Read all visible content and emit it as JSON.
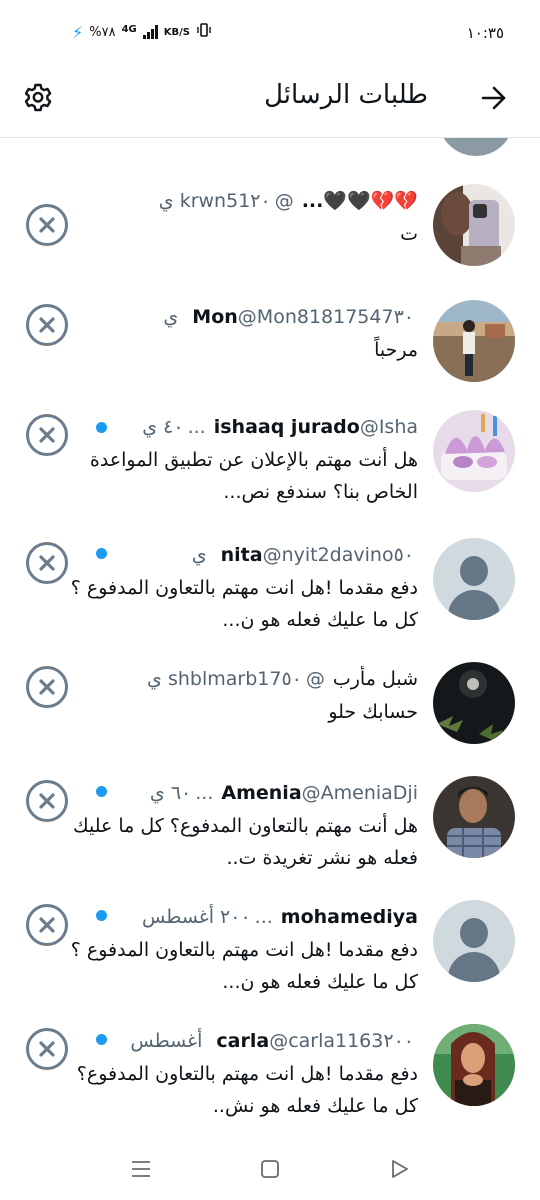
{
  "status_bar": {
    "time": "١٠:٣٥",
    "battery": "%٧٨",
    "network": "4G",
    "speed_unit": "KB/S"
  },
  "header": {
    "title": "طلبات الرسائل"
  },
  "requests": [
    {
      "name": "💔💔🖤🖤...",
      "handle": "@krwn51",
      "time": "٢٠ ي",
      "preview": "ت",
      "unread": false,
      "avatar": "photo-mirror-selfie"
    },
    {
      "name": "Mon",
      "handle": "@Mon81817547",
      "time": "٣٠ ي",
      "preview": "مرحباً",
      "unread": false,
      "avatar": "photo-man-outdoors"
    },
    {
      "name": "ishaaq jurado",
      "handle": "@Isha...",
      "time": "٤٠ ي",
      "preview": "هل أنت مهتم بالإعلان عن تطبيق المواعدة الخاص بنا؟ سندفع نص...",
      "unread": true,
      "avatar": "photo-flowers"
    },
    {
      "name": "nita",
      "handle": "@nyit2davino",
      "time": "٥٠ ي",
      "preview": "دفع مقدما !هل انت مهتم بالتعاون المدفوع ؟ كل ما عليك فعله هو ن...",
      "unread": true,
      "avatar": "default-person"
    },
    {
      "name": "شبل مأرب",
      "handle": "@shblmarb17",
      "time": "٥٠ ي",
      "preview": "حسابك حلو",
      "unread": false,
      "avatar": "photo-night-sky"
    },
    {
      "name": "Amenia",
      "handle": "@AmeniaDji...",
      "time": "٦٠ ي",
      "preview": "هل أنت مهتم بالتعاون المدفوع؟ كل ما عليك فعله هو نشر تغريدة ت..",
      "unread": true,
      "avatar": "photo-young-man"
    },
    {
      "name": "mohamediya",
      "handle": "...",
      "time": "٢٠٠ أغسطس",
      "preview": "دفع مقدما !هل انت مهتم بالتعاون المدفوع ؟ كل ما عليك فعله هو ن...",
      "unread": true,
      "avatar": "default-person"
    },
    {
      "name": "carla",
      "handle": "@carla1163",
      "time": "٢٠٠ أغسطس",
      "preview": "دفع مقدما !هل انت مهتم بالتعاون المدفوع؟ كل ما عليك فعله هو نش..",
      "unread": true,
      "avatar": "photo-woman"
    }
  ],
  "icons": {
    "back": "arrow-right-icon",
    "settings": "gear-icon",
    "dismiss": "close-circle-icon",
    "nav": [
      "recents-icon",
      "home-icon",
      "back-triangle-icon"
    ]
  },
  "colors": {
    "unread_dot": "#1d9bf0",
    "dismiss_icon": "#6b7d8c",
    "secondary_text": "#536471"
  }
}
